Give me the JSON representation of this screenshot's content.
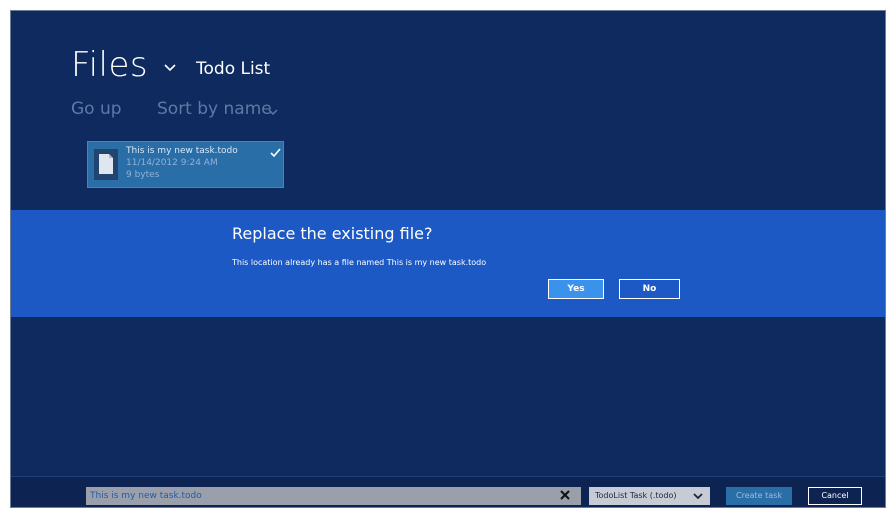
{
  "header": {
    "title": "Files",
    "location": "Todo List",
    "go_up_label": "Go up",
    "sort_label": "Sort by name"
  },
  "file_tile": {
    "name": "This is my new task.todo",
    "date": "11/14/2012 9:24 AM",
    "size": "9 bytes",
    "selected": true
  },
  "dialog": {
    "title": "Replace the existing file?",
    "message": "This location already has a file named This is my new task.todo",
    "yes_label": "Yes",
    "no_label": "No"
  },
  "bottom_bar": {
    "filename_value": "This is my new task.todo",
    "file_type": "TodoList Task (.todo)",
    "create_label": "Create task",
    "cancel_label": "Cancel"
  },
  "colors": {
    "background": "#0f2a5e",
    "dialog": "#1c59c4",
    "tile": "#2a6ea8",
    "accent": "#3a92ea"
  },
  "icons": {
    "title_dropdown": "chevron-down-icon",
    "sort_dropdown": "chevron-down-icon",
    "file": "document-icon",
    "selected": "checkmark-icon",
    "clear": "close-icon",
    "type_dropdown": "chevron-down-icon"
  }
}
